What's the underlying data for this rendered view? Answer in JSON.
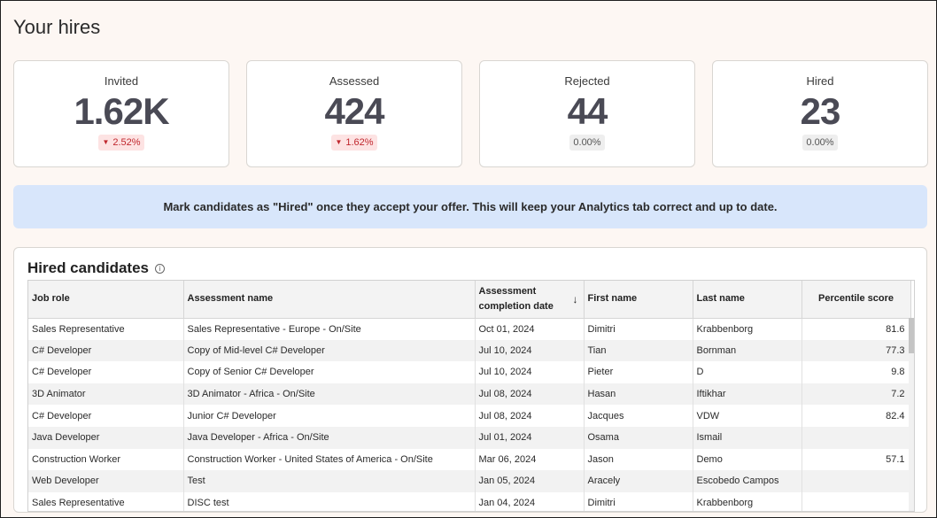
{
  "page_title": "Your hires",
  "stats": [
    {
      "label": "Invited",
      "value": "1.62K",
      "delta": "2.52%",
      "trend": "down"
    },
    {
      "label": "Assessed",
      "value": "424",
      "delta": "1.62%",
      "trend": "down"
    },
    {
      "label": "Rejected",
      "value": "44",
      "delta": "0.00%",
      "trend": "neutral"
    },
    {
      "label": "Hired",
      "value": "23",
      "delta": "0.00%",
      "trend": "neutral"
    }
  ],
  "banner_text": "Mark candidates as \"Hired\" once they accept your offer. This will keep your Analytics tab correct and up to date.",
  "hired": {
    "title": "Hired candidates",
    "info_icon": "info-icon",
    "columns": [
      "Job role",
      "Assessment name",
      "Assessment completion date",
      "First name",
      "Last name",
      "Percentile score"
    ],
    "sort_icon": "arrow-down-icon",
    "rows": [
      [
        "Sales Representative",
        "Sales Representative - Europe - On/Site",
        "Oct 01, 2024",
        "Dimitri",
        "Krabbenborg",
        "81.6"
      ],
      [
        "C# Developer",
        "Copy of Mid-level C# Developer",
        "Jul 10, 2024",
        "Tian",
        "Bornman",
        "77.3"
      ],
      [
        "C# Developer",
        "Copy of Senior C# Developer",
        "Jul 10, 2024",
        "Pieter",
        "D",
        "9.8"
      ],
      [
        "3D Animator",
        "3D Animator - Africa - On/Site",
        "Jul 08, 2024",
        "Hasan",
        "Iftikhar",
        "7.2"
      ],
      [
        "C# Developer",
        "Junior C# Developer",
        "Jul 08, 2024",
        "Jacques",
        "VDW",
        "82.4"
      ],
      [
        "Java Developer",
        "Java Developer - Africa - On/Site",
        "Jul 01, 2024",
        "Osama",
        "Ismail",
        ""
      ],
      [
        "Construction Worker",
        "Construction Worker - United States of America - On/Site",
        "Mar 06, 2024",
        "Jason",
        "Demo",
        "57.1"
      ],
      [
        "Web Developer",
        "Test",
        "Jan 05, 2024",
        "Aracely",
        "Escobedo Campos",
        ""
      ],
      [
        "Sales Representative",
        "DISC test",
        "Jan 04, 2024",
        "Dimitri",
        "Krabbenborg",
        ""
      ]
    ]
  },
  "colors": {
    "background": "#fdf7f3",
    "banner": "#d8e6fb",
    "negative_badge": "#fde3e3",
    "negative_text": "#c0262d"
  }
}
